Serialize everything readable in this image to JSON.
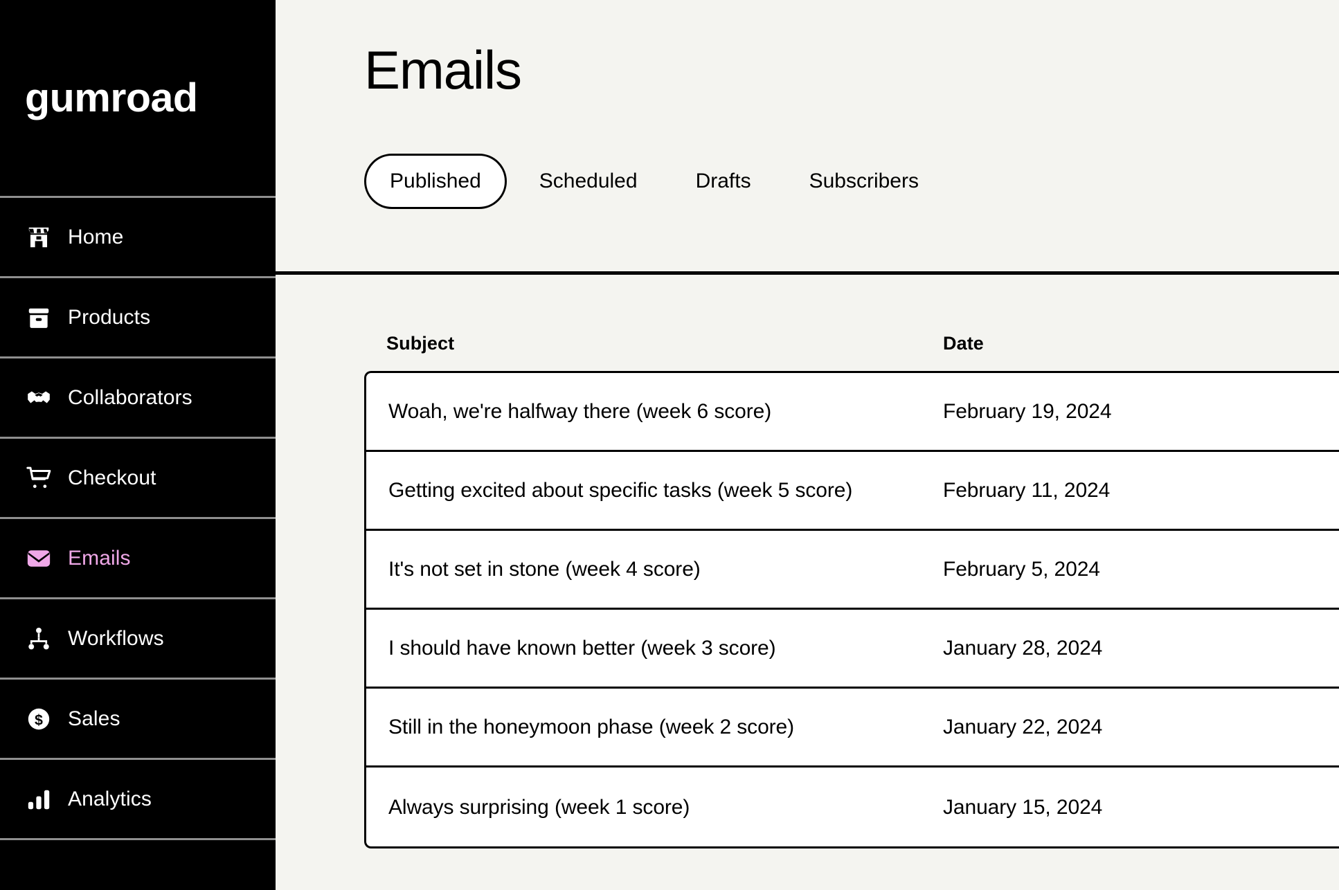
{
  "sidebar": {
    "brand": "gumroad",
    "active_color": "#f0a8e8",
    "items": [
      {
        "label": "Home",
        "icon": "shop-icon",
        "active": false
      },
      {
        "label": "Products",
        "icon": "archive-box-icon",
        "active": false
      },
      {
        "label": "Collaborators",
        "icon": "handshake-icon",
        "active": false
      },
      {
        "label": "Checkout",
        "icon": "shopping-cart-icon",
        "active": false
      },
      {
        "label": "Emails",
        "icon": "envelope-icon",
        "active": true
      },
      {
        "label": "Workflows",
        "icon": "workflow-nodes-icon",
        "active": false
      },
      {
        "label": "Sales",
        "icon": "dollar-circle-icon",
        "active": false
      },
      {
        "label": "Analytics",
        "icon": "bar-chart-icon",
        "active": false
      }
    ]
  },
  "header": {
    "title": "Emails",
    "tabs": [
      {
        "label": "Published",
        "active": true
      },
      {
        "label": "Scheduled",
        "active": false
      },
      {
        "label": "Drafts",
        "active": false
      },
      {
        "label": "Subscribers",
        "active": false
      }
    ]
  },
  "table": {
    "columns": {
      "subject": "Subject",
      "date": "Date"
    },
    "rows": [
      {
        "subject": "Woah, we're halfway there (week 6 score)",
        "date": "February 19, 2024"
      },
      {
        "subject": "Getting excited about specific tasks (week 5 score)",
        "date": "February 11, 2024"
      },
      {
        "subject": "It's not set in stone (week 4 score)",
        "date": "February 5, 2024"
      },
      {
        "subject": "I should have known better (week 3 score)",
        "date": "January 28, 2024"
      },
      {
        "subject": "Still in the honeymoon phase (week 2 score)",
        "date": "January 22, 2024"
      },
      {
        "subject": "Always surprising (week 1 score)",
        "date": "January 15, 2024"
      }
    ]
  },
  "colors": {
    "background": "#f4f4f0",
    "sidebar_bg": "#000000",
    "sidebar_divider": "#8f8f8f",
    "accent_pink": "#f0a8e8",
    "border": "#000000",
    "row_bg": "#ffffff"
  }
}
